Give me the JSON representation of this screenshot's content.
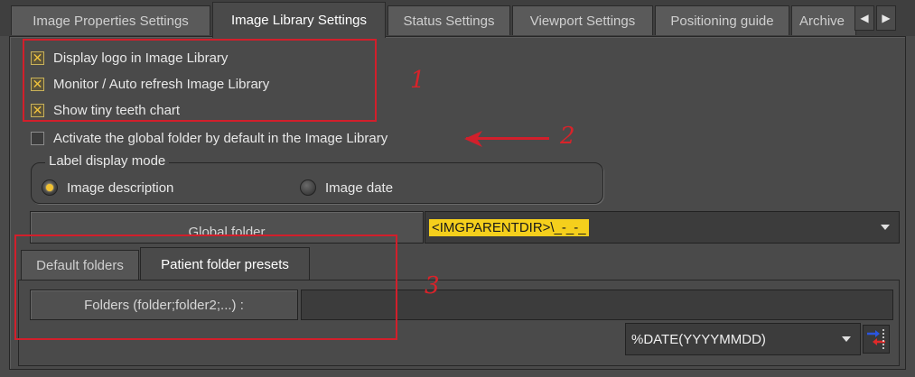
{
  "tabs": [
    {
      "label": "Image Properties Settings",
      "active": false
    },
    {
      "label": "Image Library Settings",
      "active": true
    },
    {
      "label": "Status Settings",
      "active": false
    },
    {
      "label": "Viewport Settings",
      "active": false
    },
    {
      "label": "Positioning guide",
      "active": false
    },
    {
      "label": "Archive",
      "active": false
    }
  ],
  "tab_scroll": {
    "left_icon": "triangle-left",
    "right_icon": "triangle-right",
    "left_glyph": "◀",
    "right_glyph": "▶"
  },
  "options": [
    {
      "label": "Display logo in Image Library",
      "checked": true
    },
    {
      "label": "Monitor / Auto refresh Image Library",
      "checked": true
    },
    {
      "label": "Show tiny teeth chart",
      "checked": true
    },
    {
      "label": "Activate the global folder by default in the Image Library",
      "checked": false
    }
  ],
  "check_glyph": "✕",
  "label_display_mode": {
    "title": "Label display mode",
    "options": [
      {
        "label": "Image description",
        "selected": true
      },
      {
        "label": "Image date",
        "selected": false
      }
    ]
  },
  "global_folder": {
    "button_label": "Global folder",
    "value": "<IMGPARENTDIR>\\_-_-_"
  },
  "sub_tabs": [
    {
      "label": "Default folders",
      "active": false
    },
    {
      "label": "Patient folder presets",
      "active": true
    }
  ],
  "folders": {
    "label": "Folders (folder;folder2;...) :",
    "value": "",
    "macro_value": "%DATE(YYYYMMDD)",
    "insert_icon": "insert-macro-icon"
  },
  "annotations": [
    "1",
    "2",
    "3"
  ],
  "colors": {
    "annotation_red": "#d21f2b",
    "highlight_yellow": "#f5cf1c",
    "panel_bg": "#4a4a4a"
  }
}
